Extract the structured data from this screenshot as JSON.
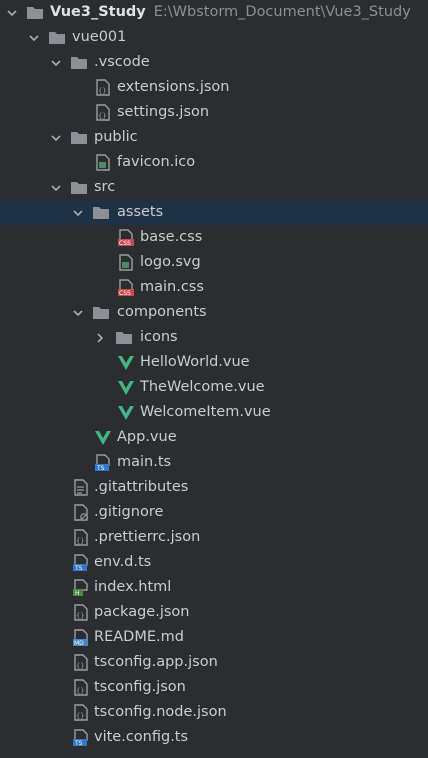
{
  "root": {
    "name": "Vue3_Study",
    "path": "E:\\Wbstorm_Document\\Vue3_Study"
  },
  "items": [
    {
      "label": "vue001",
      "icon": "folder-icon",
      "arrow": "down"
    },
    {
      "label": ".vscode",
      "icon": "folder-icon",
      "arrow": "down"
    },
    {
      "label": "extensions.json",
      "icon": "json-file-icon"
    },
    {
      "label": "settings.json",
      "icon": "json-file-icon"
    },
    {
      "label": "public",
      "icon": "folder-icon",
      "arrow": "down"
    },
    {
      "label": "favicon.ico",
      "icon": "image-file-icon"
    },
    {
      "label": "src",
      "icon": "folder-icon",
      "arrow": "down"
    },
    {
      "label": "assets",
      "icon": "folder-icon",
      "arrow": "down",
      "selected": true
    },
    {
      "label": "base.css",
      "icon": "css-file-icon"
    },
    {
      "label": "logo.svg",
      "icon": "image-file-icon"
    },
    {
      "label": "main.css",
      "icon": "css-file-icon"
    },
    {
      "label": "components",
      "icon": "folder-icon",
      "arrow": "down"
    },
    {
      "label": "icons",
      "icon": "folder-icon",
      "arrow": "right"
    },
    {
      "label": "HelloWorld.vue",
      "icon": "vue-icon"
    },
    {
      "label": "TheWelcome.vue",
      "icon": "vue-icon"
    },
    {
      "label": "WelcomeItem.vue",
      "icon": "vue-icon"
    },
    {
      "label": "App.vue",
      "icon": "vue-icon"
    },
    {
      "label": "main.ts",
      "icon": "ts-file-icon"
    },
    {
      "label": ".gitattributes",
      "icon": "text-file-icon"
    },
    {
      "label": ".gitignore",
      "icon": "ignore-file-icon"
    },
    {
      "label": ".prettierrc.json",
      "icon": "json-file-icon"
    },
    {
      "label": "env.d.ts",
      "icon": "ts-file-icon"
    },
    {
      "label": "index.html",
      "icon": "html-file-icon"
    },
    {
      "label": "package.json",
      "icon": "json-file-icon"
    },
    {
      "label": "README.md",
      "icon": "md-file-icon"
    },
    {
      "label": "tsconfig.app.json",
      "icon": "json-file-icon"
    },
    {
      "label": "tsconfig.json",
      "icon": "json-file-icon"
    },
    {
      "label": "tsconfig.node.json",
      "icon": "json-file-icon"
    },
    {
      "label": "vite.config.ts",
      "icon": "ts-file-icon"
    }
  ],
  "colors": {
    "background": "#2b2d30",
    "selected_row": "#1e3246",
    "text": "#c9cdd3",
    "path_text": "#8c8f94",
    "folder": "#8c9096",
    "vue_green": "#41b883",
    "css_red": "#c74a4a",
    "ts_blue": "#3178c6",
    "html_green": "#4c8b3f",
    "md_blue": "#4a86c5"
  }
}
